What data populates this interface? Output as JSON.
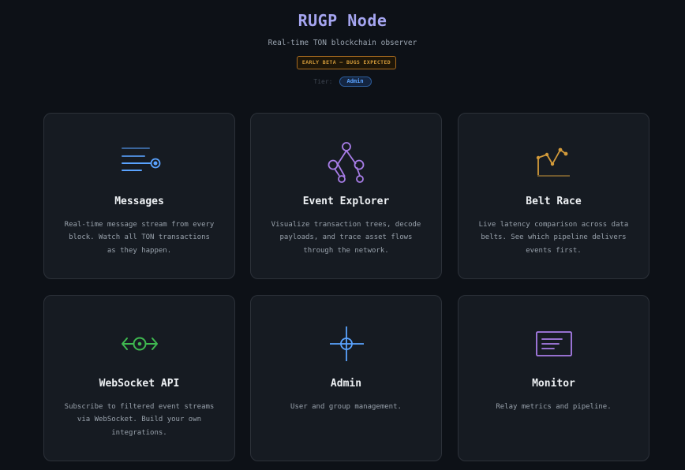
{
  "header": {
    "title": "RUGP Node",
    "subtitle": "Real-time TON blockchain observer",
    "beta_badge": "EARLY BETA — BUGS EXPECTED",
    "tier_label": "Tier:",
    "tier_value": "Admin"
  },
  "cards": [
    {
      "title": "Messages",
      "icon": "message-stream-icon",
      "description": "Real-time message stream from every block. Watch all TON transactions as they happen."
    },
    {
      "title": "Event Explorer",
      "icon": "transaction-tree-icon",
      "description": "Visualize transaction trees, decode payloads, and trace asset flows through the network."
    },
    {
      "title": "Belt Race",
      "icon": "latency-chart-icon",
      "description": "Live latency comparison across data belts. See which pipeline delivers events first."
    },
    {
      "title": "WebSocket API",
      "icon": "websocket-icon",
      "description": "Subscribe to filtered event streams via WebSocket. Build your own integrations."
    },
    {
      "title": "Admin",
      "icon": "crosshair-icon",
      "description": "User and group management."
    },
    {
      "title": "Monitor",
      "icon": "monitor-icon",
      "description": "Relay metrics and pipeline."
    }
  ],
  "colors": {
    "background": "#0d1117",
    "card": "#161b22",
    "title_accent": "#a5a5f0",
    "beta_accent": "#d29a3a",
    "tier_accent": "#5aa3ff",
    "messages_icon": "#5aa3ff",
    "explorer_icon": "#a87de8",
    "belt_icon": "#d29a3a",
    "websocket_icon": "#3fb950",
    "admin_icon": "#5aa3ff",
    "monitor_icon": "#a87de8"
  }
}
